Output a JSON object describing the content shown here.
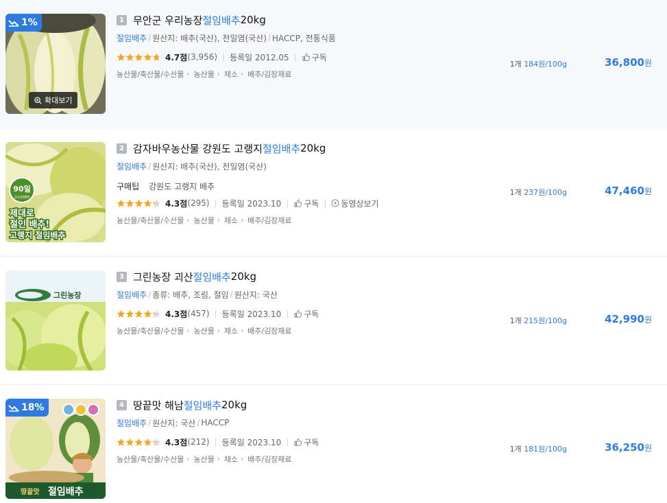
{
  "products": [
    {
      "rank": "1",
      "discount": "1%",
      "zoom_label": "확대보기",
      "title_pre": "무안군 우리농장 ",
      "title_kw": "절임배추",
      "title_post": " 20kg",
      "spec_kw": "절임배추",
      "specs": [
        "원산지: 배추(국산), 천일염(국산)",
        "HACCP, 전통식품"
      ],
      "tip_label": "",
      "tip_text": "",
      "rating": 4.7,
      "score": "4.7점",
      "reviews": "(3,956)",
      "reg_date": "등록일 2012.05",
      "subscribe": "구독",
      "video": "",
      "categories": [
        "농산물/축산물/수산물",
        "농산물",
        "채소",
        "배추/김장재료"
      ],
      "unit_prefix": "1개",
      "unit_price": "184원/100g",
      "price": "36,800",
      "won": "원"
    },
    {
      "rank": "2",
      "discount": "",
      "zoom_label": "",
      "title_pre": "감자바우농산물 강원도 고랭지",
      "title_kw": "절임배추",
      "title_post": " 20kg",
      "spec_kw": "절임배추",
      "specs": [
        "원산지: 배추(국산), 천일염(국산)"
      ],
      "tip_label": "구매팁",
      "tip_text": "강원도 고랭지 배추",
      "rating": 4.3,
      "score": "4.3점",
      "reviews": "(295)",
      "reg_date": "등록일 2023.10",
      "subscribe": "구독",
      "video": "동영상보기",
      "categories": [
        "농산물/축산물/수산물",
        "농산물",
        "채소",
        "배추/김장재료"
      ],
      "unit_prefix": "1개",
      "unit_price": "237원/100g",
      "price": "47,460",
      "won": "원",
      "image_text": {
        "days": "90일",
        "days_sub": "고소한배추",
        "line1": "제대로",
        "line2": "절인 배추!",
        "line3": "고랭지 절임배추"
      }
    },
    {
      "rank": "3",
      "discount": "",
      "zoom_label": "",
      "title_pre": "그린농장 괴산 ",
      "title_kw": "절임배추",
      "title_post": " 20kg",
      "spec_kw": "절임배추",
      "specs": [
        "종류: 배추, 조림, 절임",
        "원산지: 국산"
      ],
      "tip_label": "",
      "tip_text": "",
      "rating": 4.3,
      "score": "4.3점",
      "reviews": "(457)",
      "reg_date": "등록일 2023.10",
      "subscribe": "구독",
      "video": "",
      "categories": [
        "농산물/축산물/수산물",
        "농산물",
        "채소",
        "배추/김장재료"
      ],
      "unit_prefix": "1개",
      "unit_price": "215원/100g",
      "price": "42,990",
      "won": "원",
      "image_text": {
        "logo": "그린농장"
      }
    },
    {
      "rank": "4",
      "discount": "18%",
      "zoom_label": "",
      "title_pre": "땅끝맛 해남 ",
      "title_kw": "절임배추",
      "title_post": " 20kg",
      "spec_kw": "절임배추",
      "specs": [
        "원산지: 국산",
        "HACCP"
      ],
      "tip_label": "",
      "tip_text": "",
      "rating": 4.3,
      "score": "4.3점",
      "reviews": "(212)",
      "reg_date": "등록일 2023.10",
      "subscribe": "구독",
      "video": "",
      "categories": [
        "농산물/축산물/수산물",
        "농산물",
        "채소",
        "배추/김장재료"
      ],
      "unit_prefix": "1개",
      "unit_price": "181원/100g",
      "price": "36,250",
      "won": "원",
      "image_text": {
        "banner_small": "땅끝맛",
        "banner_big": "절임배추"
      }
    }
  ],
  "colors": {
    "accent": "#2d7be0",
    "star": "#f5a623",
    "star_empty": "#d8d8d8"
  }
}
